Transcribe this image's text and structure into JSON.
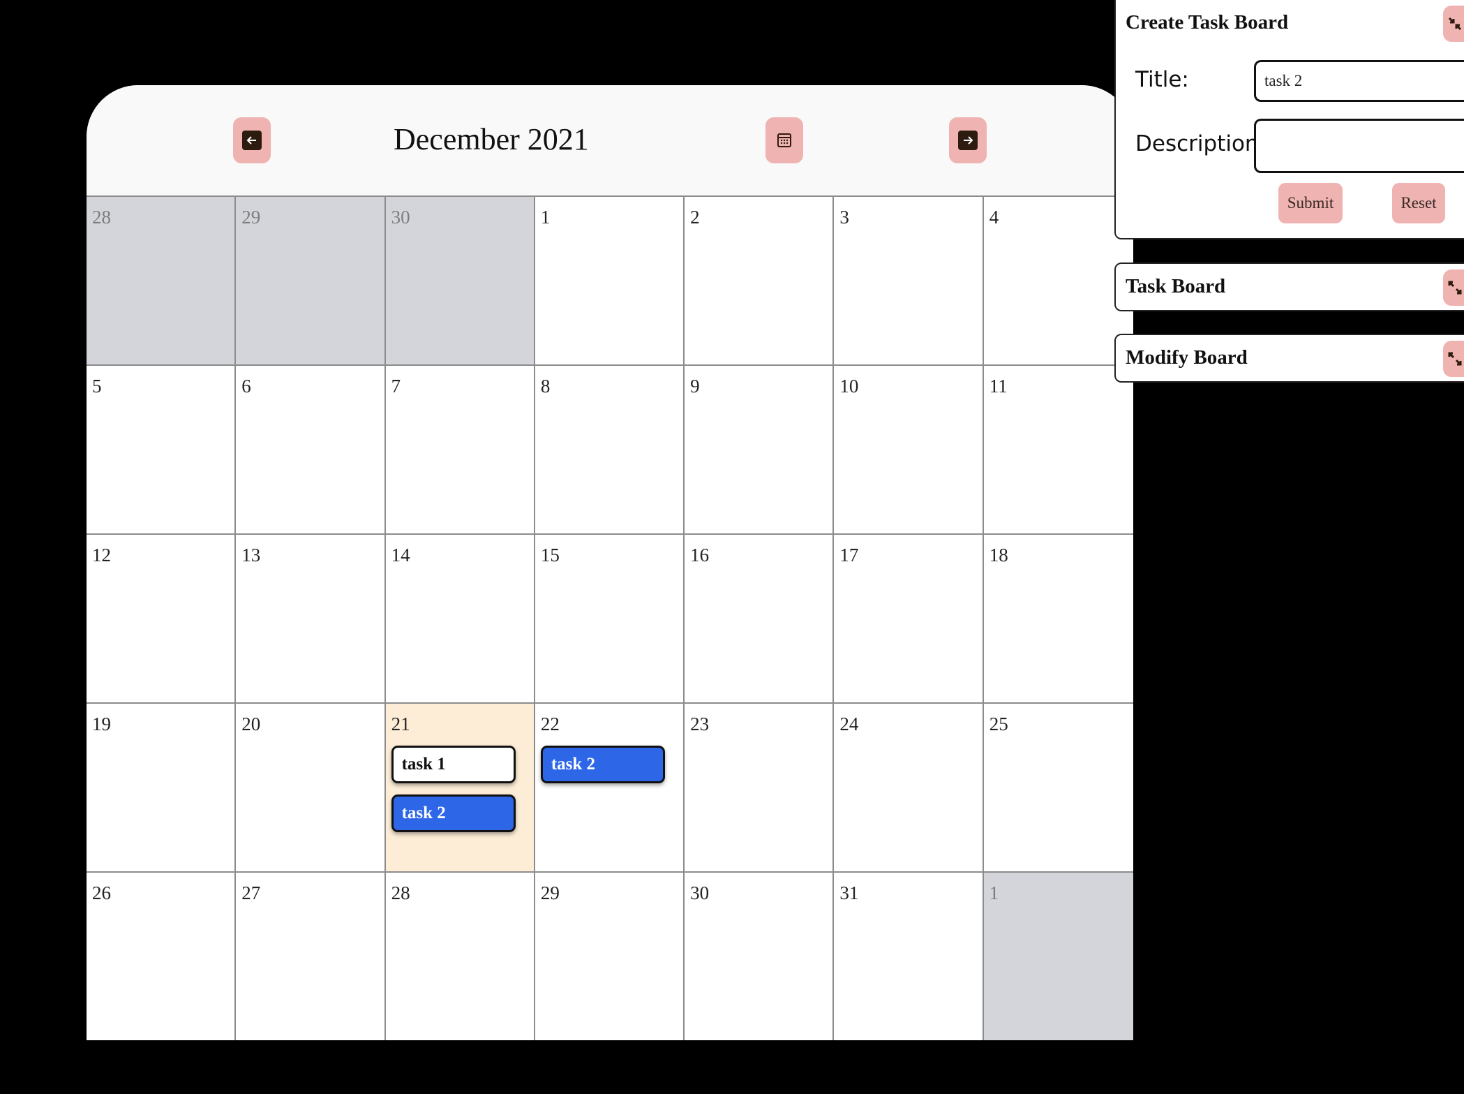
{
  "calendar": {
    "month_label": "December 2021",
    "prev_icon": "arrow-left-icon",
    "today_icon": "calendar-icon",
    "next_icon": "arrow-right-icon",
    "cells": [
      {
        "day": "28",
        "other": true
      },
      {
        "day": "29",
        "other": true
      },
      {
        "day": "30",
        "other": true
      },
      {
        "day": "1"
      },
      {
        "day": "2"
      },
      {
        "day": "3"
      },
      {
        "day": "4"
      },
      {
        "day": "5"
      },
      {
        "day": "6"
      },
      {
        "day": "7"
      },
      {
        "day": "8"
      },
      {
        "day": "9"
      },
      {
        "day": "10"
      },
      {
        "day": "11"
      },
      {
        "day": "12"
      },
      {
        "day": "13"
      },
      {
        "day": "14"
      },
      {
        "day": "15"
      },
      {
        "day": "16"
      },
      {
        "day": "17"
      },
      {
        "day": "18"
      },
      {
        "day": "19"
      },
      {
        "day": "20"
      },
      {
        "day": "21",
        "today": true,
        "tasks": [
          {
            "label": "task 1",
            "style": "white"
          },
          {
            "label": "task 2",
            "style": "blue"
          }
        ]
      },
      {
        "day": "22",
        "tasks": [
          {
            "label": "task 2",
            "style": "blue"
          }
        ]
      },
      {
        "day": "23"
      },
      {
        "day": "24"
      },
      {
        "day": "25"
      },
      {
        "day": "26"
      },
      {
        "day": "27"
      },
      {
        "day": "28"
      },
      {
        "day": "29"
      },
      {
        "day": "30"
      },
      {
        "day": "31"
      },
      {
        "day": "1",
        "other": true
      }
    ]
  },
  "create_panel": {
    "title": "Create Task Board",
    "title_label": "Title:",
    "title_value": "task 2",
    "description_label": "Description:",
    "description_value": "",
    "submit_label": "Submit",
    "reset_label": "Reset",
    "toggle_icon": "collapse-icon"
  },
  "task_board_panel": {
    "title": "Task Board",
    "toggle_icon": "expand-icon"
  },
  "modify_board_panel": {
    "title": "Modify Board",
    "toggle_icon": "expand-icon"
  },
  "colors": {
    "accent_button": "#efb3b1",
    "today_cell": "#fdedd6",
    "other_month_cell": "#d3d5db",
    "task_blue": "#2d66e6"
  }
}
